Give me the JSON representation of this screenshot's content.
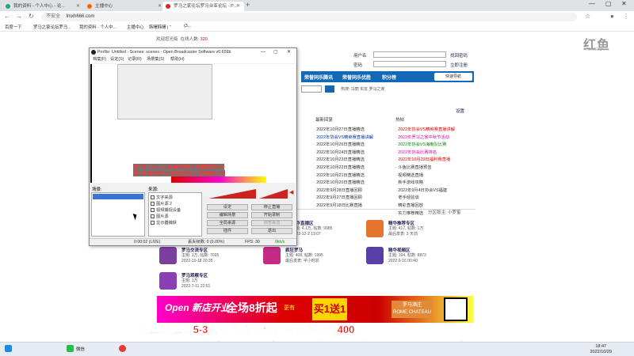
{
  "browser": {
    "tabs": [
      {
        "label": "我的资料 - 个人中心 - 论..."
      },
      {
        "label": "主播中心"
      },
      {
        "label": "罗马之家论坛罗马台亚论坛 - P..."
      }
    ],
    "new_tab": "+",
    "address": "lmxh666.com",
    "security_text": "不安全",
    "bookmarks": [
      "百度一下",
      "罗马之家论坛罗马...",
      "我的资料 - 个人中...",
      "主播中心",
      "韩曙韩曙 | \"",
      "(3..."
    ]
  },
  "site": {
    "welcome": "欢迎您光临",
    "welcome_count_label": "在线人数",
    "welcome_count": "320",
    "logo": "红鱼",
    "logo_sub": "HONGYU",
    "login": {
      "user_label": "用户名",
      "pass_label": "密码",
      "forgot": "找回密码",
      "register": "立即注册",
      "login_btn": "登录"
    },
    "nav": [
      "荣誉同乐腾讯",
      "荣誉同乐优胜",
      "积分榜"
    ],
    "search_btn": "快速导航",
    "search_hot_label": "热搜:",
    "search_hot": "马丽 实友 罗马之家",
    "menu_label": "设置",
    "columns": [
      {
        "title": "最新图片"
      },
      {
        "title": "最新回复"
      },
      {
        "title": "热帖"
      }
    ],
    "list_recent": [
      "2022年10月27日直播精选",
      "2022年协会VS精英赛直播讲解",
      "2022年10月26日直播精选",
      "2022年10月24日直播精选",
      "2022年10月23日直播精选",
      "2022年10月22日直播精选",
      "2022年10月21日直播精选",
      "2022年10月20日直播精选",
      "2022年9月28日直播回顾",
      "2022年9月27日直播回顾",
      "2022年9月18日比赛直播"
    ],
    "list_hot": [
      "2022年协会VS精英赛直播讲解",
      "2022年罗马之家中秋节活动",
      "2022年协会VS海南队比赛",
      "2022年协会比赛排名",
      "2022年10月29日福利赛直播",
      "斗鱼比赛直播预告",
      "视频精选直播",
      "新手游戏攻略",
      "2022年9月4日协会VS福建",
      "老手经验谈",
      "精彩直播回放",
      "实力推荐精选"
    ],
    "section_label": "分区版主: 小罗蜜",
    "forums": [
      {
        "name": "精华直播区",
        "m1": "主题: 4.1万, 帖数: 9985",
        "m2": "2022-12-2 13:07"
      },
      {
        "name": "精华推荐专区",
        "m1": "主题: 417, 帖数: 1万",
        "m2": "最后发表: 3 天前"
      },
      {
        "name": "罗马交流专区",
        "m1": "主题: 1万, 帖数: 7035",
        "m2": "2022-10-18 20:35"
      },
      {
        "name": "疯狂罗马",
        "m1": "主题: 408, 帖数: 1995",
        "m2": "最后发表: 半小时前"
      },
      {
        "name": "精华视频区",
        "m1": "主题: 194, 帖数: 8873",
        "m2": "2022-9-16 00:40"
      },
      {
        "name": "罗马观察专区",
        "m1": "主题: 1万",
        "m2": "2022-7-11 22:51"
      }
    ],
    "banner": {
      "brand": "Open 新店开业",
      "slogan": "全场8折起",
      "extra": "更有",
      "buy": "买1送1",
      "hotel": "罗马酒庄",
      "hotel_en": "ROME CHATEAU"
    }
  },
  "obs": {
    "title": "Profile: Untitled - Scenes: scenes - Open Broadcaster Software v0.659b",
    "menu": [
      "档案(F)",
      "设定(S)",
      "记录(R)",
      "场景集(S)",
      "帮助(H)"
    ],
    "scenes_label": "场景:",
    "sources_label": "来源:",
    "scene_item": "场景",
    "sources": [
      "文字来源",
      "图片源 2",
      "视频捕捉设备",
      "图片源",
      "显示器捕获"
    ],
    "overlay_lines": [
      "第二场  二少5-3火海  越南随机  由陈祖丞赞助400",
      "第三场 协会鹰仔 (3分钟死1农) 4-1滴滴箭马王彬"
    ],
    "buttons": [
      "设定",
      "停止直播",
      "编辑场景",
      "开始录制",
      "全局来源",
      "预览串流",
      "插件",
      "退出"
    ],
    "status": [
      "0:00:02 (LIVE)",
      "丢失帧数: 0 (0.00%)",
      "FPS: 30",
      "0kb/s"
    ]
  },
  "overlay": {
    "line1": "第二场  二少5-3火海  越南随机  由陈祖丞赞助400",
    "line2": "第三场 协会鹰仔 (3分钟死1农) 4-1滴滴箭马王彬 商  赢200:输100:由快乐哥赞助",
    "line3": "第三场 协会鹰仔 (3分钟死1农) 4-1滴滴箭马王彬 商 赢200:输100:由快乐哥赞助"
  },
  "taskbar": {
    "apps": [
      "微信"
    ],
    "time": "18:47",
    "date": "2022/10/29"
  }
}
